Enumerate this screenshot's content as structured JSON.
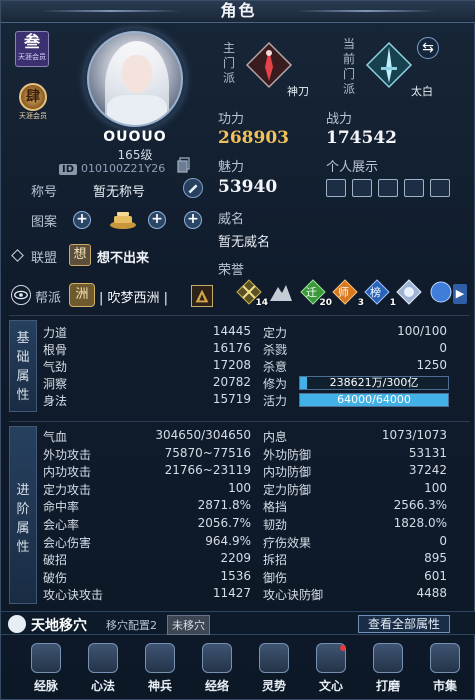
{
  "title": "角色",
  "profile": {
    "badge_big": "叁",
    "badge_small": "天涯会员",
    "seal_big": "肆",
    "seal_small": "天涯会员",
    "name": "OUOUO",
    "level": "165级",
    "id_tag": "ID",
    "id_value": "010100Z21Y26",
    "title_label": "称号",
    "title_value": "暂无称号",
    "pattern_label": "图案",
    "league_label": "联盟",
    "league_tag": "想",
    "league_value": "想不出来",
    "sect_label": "帮派",
    "sect_tag": "洲",
    "sect_value": "| 吹梦西洲 |"
  },
  "sects": {
    "main_label": "主门派",
    "main_name": "神刀",
    "current_label": "当前门派",
    "current_name": "太白"
  },
  "stats": {
    "gongli_label": "功力",
    "gongli": "268903",
    "zhanli_label": "战力",
    "zhanli": "174542",
    "meili_label": "魅力",
    "meili": "53940",
    "showcase_label": "个人展示",
    "weiming_label": "威名",
    "weiming_value": "暂无威名",
    "honor_label": "荣誉"
  },
  "honors": [
    {
      "icon": "swords-honor-icon",
      "num": "14"
    },
    {
      "icon": "mountain-honor-icon",
      "num": ""
    },
    {
      "icon": "tu-honor-icon",
      "num": "20",
      "glyph": "迁"
    },
    {
      "icon": "shi-honor-icon",
      "num": "3",
      "glyph": "师"
    },
    {
      "icon": "bang-honor-icon",
      "num": "1",
      "glyph": "榜"
    },
    {
      "icon": "crystal-honor-icon",
      "num": ""
    },
    {
      "icon": "blue-orb-honor-icon",
      "num": ""
    }
  ],
  "basic": {
    "tab": [
      "基",
      "础",
      "属",
      "性"
    ],
    "left": [
      {
        "label": "力道",
        "value": "14445"
      },
      {
        "label": "根骨",
        "value": "16176"
      },
      {
        "label": "气劲",
        "value": "17208"
      },
      {
        "label": "洞察",
        "value": "20782"
      },
      {
        "label": "身法",
        "value": "15719"
      }
    ],
    "right": [
      {
        "label": "定力",
        "value": "100/100"
      },
      {
        "label": "杀戮",
        "value": "0"
      },
      {
        "label": "杀意",
        "value": "1250"
      }
    ],
    "xiuwei_label": "修为",
    "xiuwei_text": "238621万/300亿",
    "xiuwei_fraction": 0.008,
    "huoli_label": "活力",
    "huoli_text": "64000/64000",
    "huoli_fraction": 1.0
  },
  "advanced": {
    "tab": [
      "进",
      "阶",
      "属",
      "性"
    ],
    "left": [
      {
        "label": "气血",
        "value": "304650/304650"
      },
      {
        "label": "外功攻击",
        "value": "75870~77516"
      },
      {
        "label": "内功攻击",
        "value": "21766~23119"
      },
      {
        "label": "定力攻击",
        "value": "100"
      },
      {
        "label": "命中率",
        "value": "2871.8%"
      },
      {
        "label": "会心率",
        "value": "2056.7%"
      },
      {
        "label": "会心伤害",
        "value": "964.9%"
      },
      {
        "label": "破招",
        "value": "2209"
      },
      {
        "label": "破伤",
        "value": "1536"
      },
      {
        "label": "攻心诀攻击",
        "value": "11427"
      }
    ],
    "right": [
      {
        "label": "内息",
        "value": "1073/1073"
      },
      {
        "label": "外功防御",
        "value": "53131"
      },
      {
        "label": "内功防御",
        "value": "37242"
      },
      {
        "label": "定力防御",
        "value": "100"
      },
      {
        "label": "格挡",
        "value": "2566.3%"
      },
      {
        "label": "韧劲",
        "value": "1828.0%"
      },
      {
        "label": "疗伤效果",
        "value": "0"
      },
      {
        "label": "拆招",
        "value": "895"
      },
      {
        "label": "御伤",
        "value": "601"
      },
      {
        "label": "攻心诀防御",
        "value": "4488"
      }
    ]
  },
  "move": {
    "title": "天地移穴",
    "config": "移穴配置2",
    "tag": "未移穴",
    "view_all": "查看全部属性"
  },
  "nav": [
    {
      "label": "经脉",
      "icon": "meridian-icon"
    },
    {
      "label": "心法",
      "icon": "scroll-icon"
    },
    {
      "label": "神兵",
      "icon": "weapon-icon"
    },
    {
      "label": "经络",
      "icon": "grid-icon"
    },
    {
      "label": "灵势",
      "icon": "spirit-icon"
    },
    {
      "label": "文心",
      "icon": "brush-icon"
    },
    {
      "label": "打磨",
      "icon": "hammer-icon"
    },
    {
      "label": "市集",
      "icon": "market-icon"
    }
  ]
}
